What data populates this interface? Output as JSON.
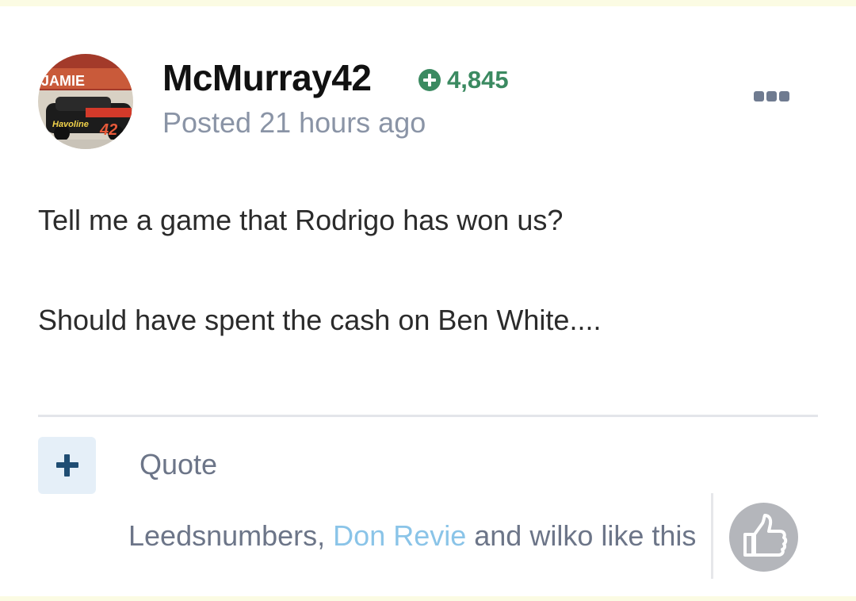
{
  "post": {
    "author": "McMurray42",
    "reputation": "4,845",
    "posted": "Posted 21 hours ago",
    "body": [
      "Tell me a game that Rodrigo has won us?",
      "Should have spent the cash on Ben White...."
    ],
    "avatar_text": {
      "top": "JAMIE",
      "number": "42",
      "sponsor": "Havoline"
    }
  },
  "actions": {
    "quote_label": "Quote"
  },
  "likes": {
    "user1": "Leedsnumbers",
    "sep1": ", ",
    "user2": "Don Revie",
    "middle": " and ",
    "user3": "wilko",
    "suffix": " like this"
  },
  "icons": {
    "reputation": "plus-circle-icon",
    "more": "ellipsis-icon",
    "add": "plus-icon",
    "like": "thumbs-up-icon"
  },
  "colors": {
    "reputation_green": "#3b8a61",
    "highlight_blue": "#8ac4e8",
    "muted_text": "#6c7588",
    "accent_strip": "#fbfbe3"
  }
}
